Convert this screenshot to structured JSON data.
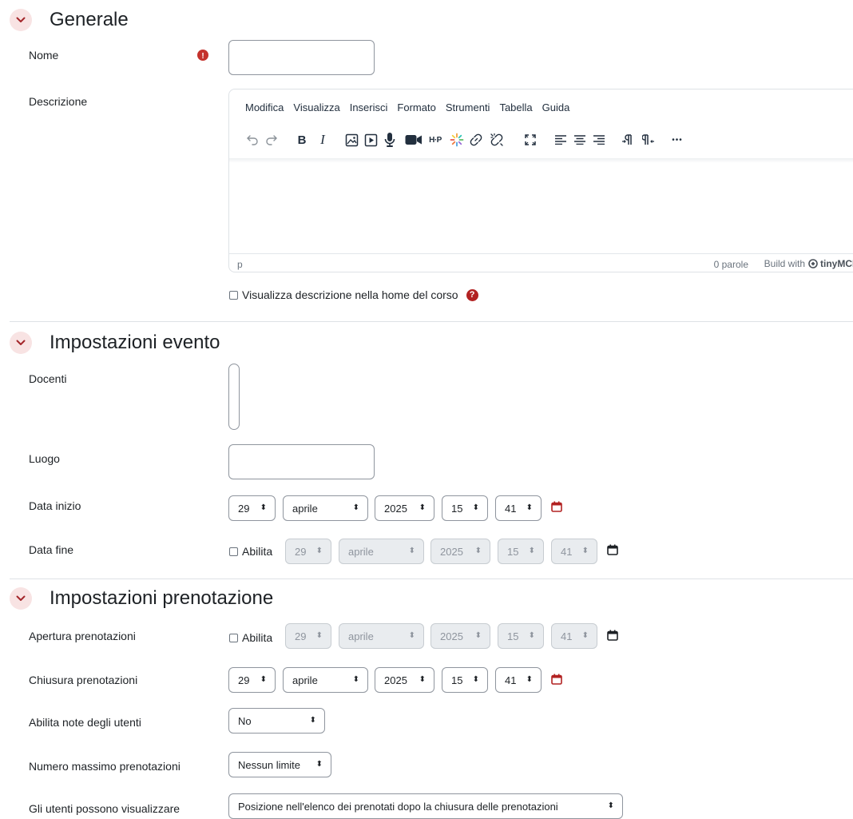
{
  "sections": {
    "general": "Generale",
    "event": "Impostazioni evento",
    "booking": "Impostazioni prenotazione"
  },
  "fields": {
    "name_label": "Nome",
    "name_value": "",
    "description_label": "Descrizione",
    "show_description_label": "Visualizza descrizione nella home del corso",
    "teachers_label": "Docenti",
    "location_label": "Luogo",
    "location_value": "",
    "start_date_label": "Data inizio",
    "end_date_label": "Data fine",
    "booking_open_label": "Apertura prenotazioni",
    "booking_close_label": "Chiusura prenotazioni",
    "user_notes_label": "Abilita note degli utenti",
    "max_bookings_label": "Numero massimo prenotazioni",
    "users_view_label": "Gli utenti possono visualizzare"
  },
  "editor": {
    "menu": [
      "Modifica",
      "Visualizza",
      "Inserisci",
      "Formato",
      "Strumenti",
      "Tabella",
      "Guida"
    ],
    "path": "p",
    "words": "0 parole",
    "build_prefix": "Build with",
    "build_brand": "tinyMCE",
    "toolbar_icons": [
      "undo-icon",
      "redo-icon",
      "bold-icon",
      "italic-icon",
      "image-icon",
      "media-icon",
      "microphone-icon",
      "video-camera-icon",
      "h5p-icon",
      "sparkle-icon",
      "link-icon",
      "unlink-icon",
      "fullscreen-icon",
      "align-left-icon",
      "align-center-icon",
      "align-right-icon",
      "ltr-icon",
      "rtl-icon",
      "more-icon"
    ],
    "bold_glyph": "B",
    "italic_glyph": "I",
    "h5p_glyph": "H·P",
    "more_glyph": "•••"
  },
  "datetime": {
    "day": "29",
    "month": "aprile",
    "year": "2025",
    "hour": "15",
    "minute": "41",
    "enable_label": "Abilita"
  },
  "selects": {
    "user_notes": "No",
    "max_bookings": "Nessun limite",
    "users_view": "Posizione nell'elenco dei prenotati dopo la chiusura delle prenotazioni"
  },
  "help_glyph": "?",
  "required_glyph": "!",
  "select_arrow": "⬍",
  "colors": {
    "accent_red": "#b22222",
    "chevron_bg": "#f8e3e3",
    "border": "#8f959e"
  }
}
